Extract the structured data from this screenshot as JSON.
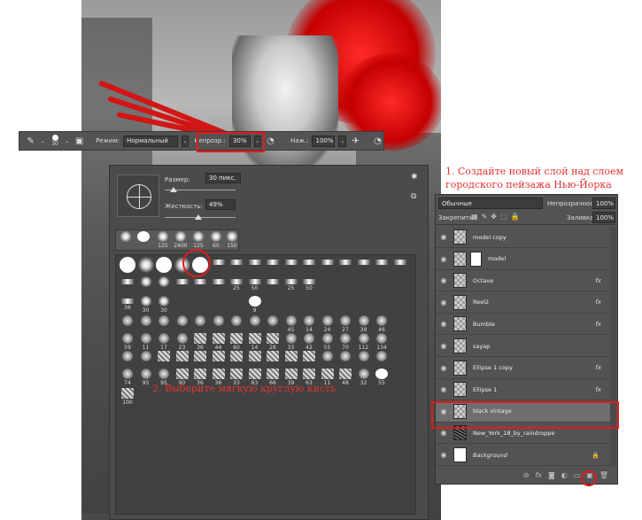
{
  "options_bar": {
    "brush_size": "30",
    "mode_label": "Режим:",
    "mode_value": "Нормальный",
    "opacity_label": "Непрозр.:",
    "opacity_value": "30%",
    "flow_label": "Наж.:",
    "flow_value": "100%"
  },
  "brush_picker": {
    "size_label": "Размер:",
    "size_value": "30 пикс.",
    "hardness_label": "Жесткость:",
    "hardness_value": "49%",
    "preset_numbers": [
      "125",
      "2400",
      "125",
      "60",
      "150"
    ],
    "grid_rows": [
      [
        "",
        "",
        "",
        "",
        "",
        "",
        "",
        "",
        "",
        "",
        "",
        "",
        "",
        "",
        "",
        ""
      ],
      [
        "",
        "",
        "",
        "",
        "",
        "",
        "25",
        "50",
        "",
        "25",
        "50",
        "",
        "",
        "",
        "",
        ""
      ],
      [
        "36",
        "30",
        "30",
        "",
        "",
        "",
        "",
        "9",
        "",
        "",
        "",
        "",
        "",
        "",
        "",
        ""
      ],
      [
        "",
        "",
        "",
        "",
        "",
        "",
        "",
        "",
        "",
        "45",
        "14",
        "24",
        "27",
        "39",
        "46",
        ""
      ],
      [
        "59",
        "11",
        "17",
        "23",
        "36",
        "44",
        "60",
        "14",
        "26",
        "33",
        "42",
        "55",
        "70",
        "112",
        "134",
        ""
      ],
      [
        "",
        "",
        "",
        "",
        "",
        "",
        "",
        "",
        "",
        "",
        "",
        "",
        "",
        "",
        "",
        ""
      ],
      [
        "74",
        "95",
        "95",
        "90",
        "36",
        "36",
        "33",
        "63",
        "66",
        "39",
        "63",
        "11",
        "48",
        "32",
        "55",
        ""
      ],
      [
        "100",
        "",
        "",
        "",
        "",
        "",
        "",
        "",
        "",
        "",
        "",
        "",
        "",
        "",
        "",
        ""
      ]
    ]
  },
  "annotations": {
    "step1": "1. Создайте новый слой над слоем городского пейзажа Нью-Йорка",
    "step2": "2. Выберите мягкую круглую кисть"
  },
  "layers_panel": {
    "blend_mode": "Обычные",
    "opacity_label": "Непрозрачность:",
    "opacity_value": "100%",
    "lock_label": "Закрепить:",
    "fill_label": "Заливка:",
    "fill_value": "100%",
    "layers": [
      {
        "name": "model copy",
        "fx": false
      },
      {
        "name": "model",
        "fx": false
      },
      {
        "name": "Octave",
        "fx": true
      },
      {
        "name": "Reel2",
        "fx": true
      },
      {
        "name": "Bumble",
        "fx": true
      },
      {
        "name": "sayap",
        "fx": false
      },
      {
        "name": "Ellipse 1 copy",
        "fx": true
      },
      {
        "name": "Ellipse 1",
        "fx": true
      },
      {
        "name": "black vintage",
        "fx": false
      },
      {
        "name": "New_York_18_by_raindroppe",
        "fx": false
      },
      {
        "name": "Background",
        "fx": false
      }
    ],
    "fx_label": "fx"
  },
  "colors": {
    "accent_red": "#e21b1b",
    "panel_bg": "#535353",
    "annotation_red": "#e03434"
  }
}
